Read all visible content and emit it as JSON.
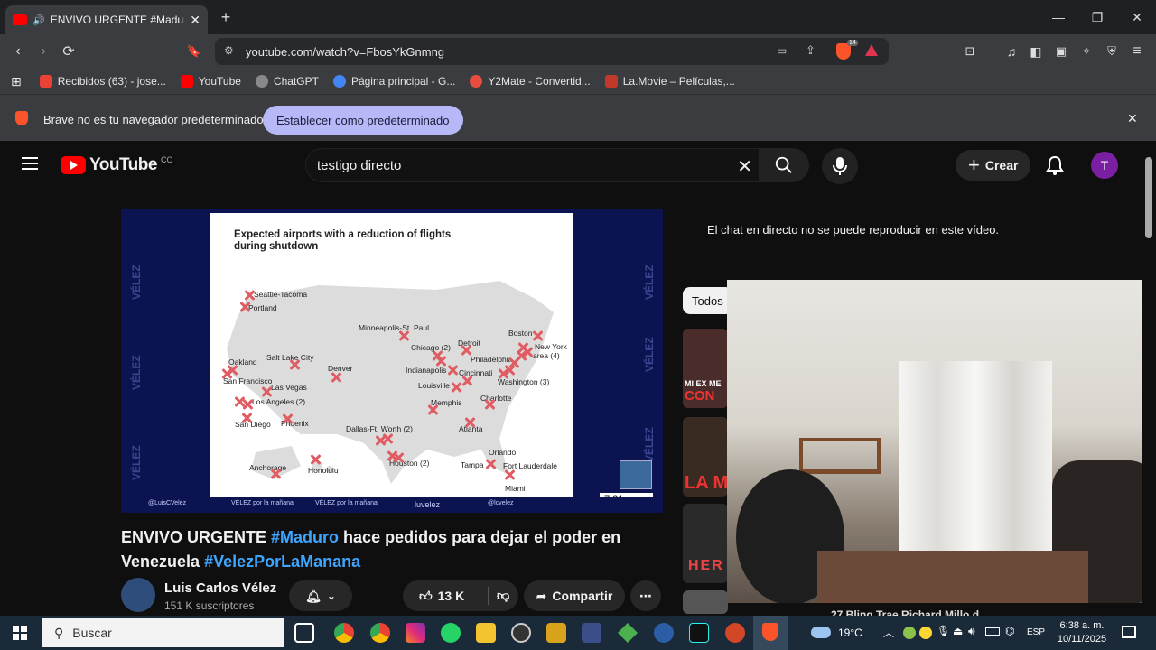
{
  "browser": {
    "tab_title": "ENVIVO URGENTE #Maduro h",
    "url": "youtube.com/watch?v=FbosYkGnmng",
    "extension_badge": "14",
    "bookmarks": [
      {
        "label": "Recibidos (63) - jose...",
        "icon": "gmail-icon",
        "color": "#ea4335"
      },
      {
        "label": "YouTube",
        "icon": "youtube-icon",
        "color": "#ff0000"
      },
      {
        "label": "ChatGPT",
        "icon": "chatgpt-icon",
        "color": "#cccccc"
      },
      {
        "label": "Página principal - G...",
        "icon": "google-icon",
        "color": "#4285f4"
      },
      {
        "label": "Y2Mate - Convertid...",
        "icon": "y2mate-icon",
        "color": "#e74c3c"
      },
      {
        "label": "La.Movie – Películas,...",
        "icon": "lamovie-icon",
        "color": "#c0392b"
      }
    ],
    "infobar": {
      "message": "Brave no es tu navegador predeterminado",
      "button": "Establecer como predeterminado"
    }
  },
  "youtube": {
    "logo_text": "YouTube",
    "country": "CO",
    "search_value": "testigo directo",
    "create_label": "Crear",
    "avatar_letter": "T"
  },
  "video": {
    "slide_title": "Expected airports with a reduction of flights during shutdown",
    "cities": [
      "Seattle-Tacoma",
      "Portland",
      "Oakland",
      "San Francisco",
      "Salt Lake City",
      "Las Vegas",
      "Los Angeles (2)",
      "San Diego",
      "Phoenix",
      "Denver",
      "Minneapolis-St. Paul",
      "Chicago (2)",
      "Detroit",
      "Boston",
      "New York",
      "area (4)",
      "Philadelphia",
      "Indianapolis",
      "Cincinnati",
      "Louisville",
      "Washington (3)",
      "Memphis",
      "Charlotte",
      "Atlanta",
      "Dallas-Ft. Worth (2)",
      "Houston (2)",
      "Orlando",
      "Tampa",
      "Fort Lauderdale",
      "Miami",
      "Anchorage",
      "Honolulu"
    ],
    "watermark": "VÉLEZ",
    "timestamp": "7:21 a. m.",
    "footer": [
      "@LuisCVelez",
      "VÉLEZ por la mañana",
      "VÉLEZ por la mañana",
      "luvelez",
      "@lcvelez"
    ],
    "title_part1": "ENVIVO URGENTE ",
    "title_tag1": "#Maduro",
    "title_part2": " hace pedidos para dejar el poder en Venezuela ",
    "title_tag2": "#VelezPorLaManana",
    "channel_name": "Luis Carlos Vélez",
    "subscribers": "151 K suscriptores",
    "likes": "13 K",
    "share_label": "Compartir"
  },
  "sidebar": {
    "chat_message": "El chat en directo no se puede reproducir en este vídeo.",
    "filter_chip": "Todos",
    "thumb_texts": [
      "MI EX ME",
      "CON",
      "LA M",
      "HER"
    ],
    "webcam_caption": "27 Bling Trae Richard Millo d"
  },
  "taskbar": {
    "search_placeholder": "Buscar",
    "weather": "19°C",
    "language": "ESP",
    "time": "6:38 a. m.",
    "date": "10/11/2025"
  }
}
